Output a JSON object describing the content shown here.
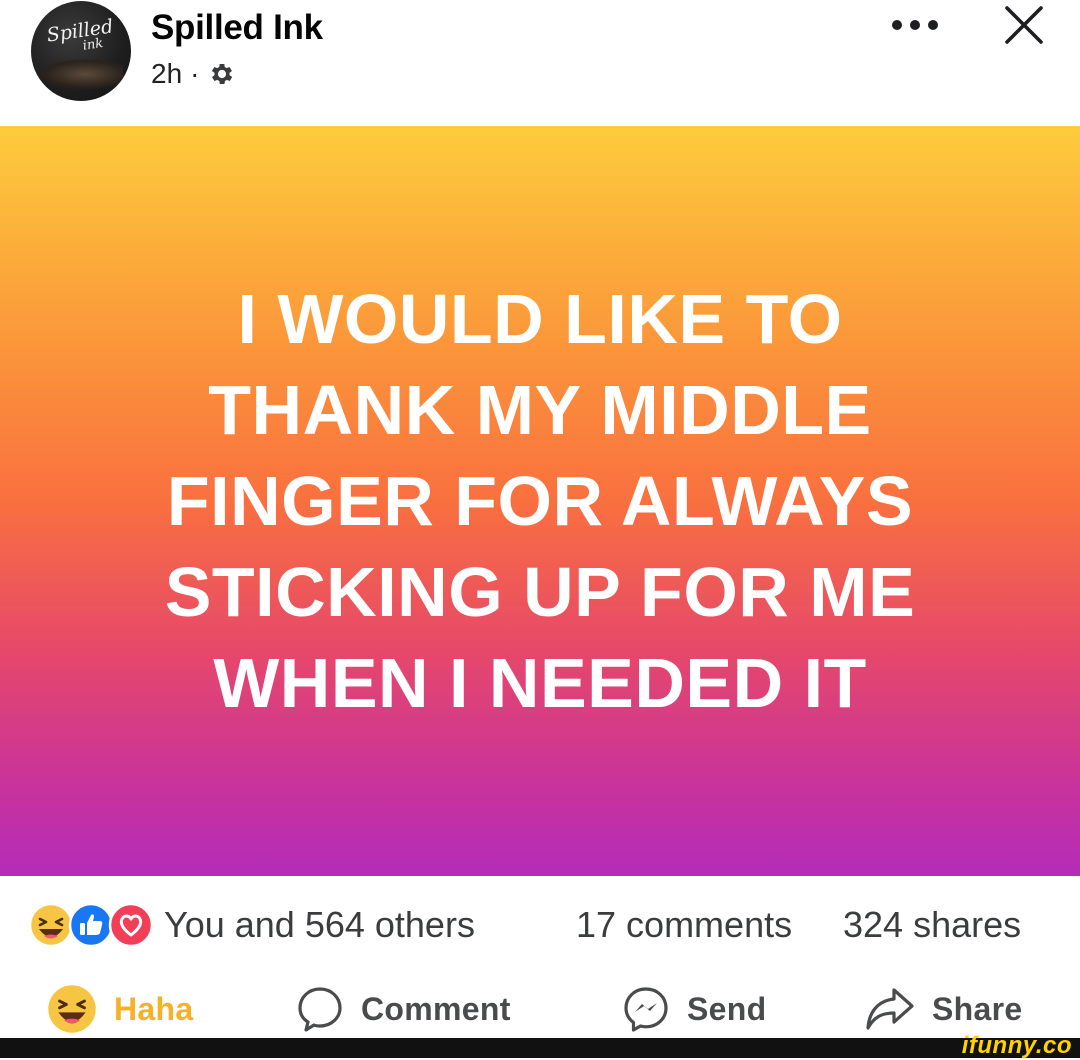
{
  "post": {
    "author": "Spilled Ink",
    "time": "2h",
    "separator": "·",
    "privacy_icon": "gear-icon",
    "more_icon": "more-horizontal-icon",
    "close_icon": "close-icon",
    "avatar_text": "Spilled",
    "avatar_subtext": "ink"
  },
  "image": {
    "text": "I WOULD LIKE TO\nTHANK MY MIDDLE\nFINGER FOR ALWAYS\nSTICKING UP FOR ME\nWHEN I NEEDED IT",
    "gradient_top": "#fdcc3c",
    "gradient_middle": "#f9703f",
    "gradient_bottom": "#b42cb8"
  },
  "stats": {
    "reaction_icons": [
      "haha-icon",
      "like-icon",
      "love-icon"
    ],
    "reactions_text": "You and 564 others",
    "comments_text": "17 comments",
    "shares_text": "324 shares"
  },
  "actions": {
    "haha_label": "Haha",
    "comment_label": "Comment",
    "send_label": "Send",
    "share_label": "Share"
  },
  "watermark": "ifunny.co"
}
